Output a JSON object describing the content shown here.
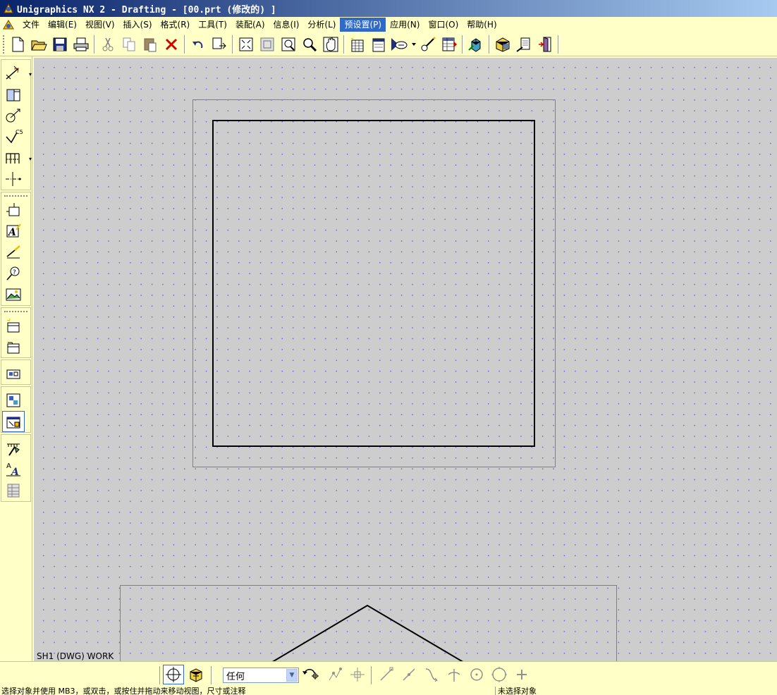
{
  "window": {
    "title": "Unigraphics NX 2 - Drafting - [00.prt  (修改的) ]"
  },
  "menu": [
    {
      "label": "文件"
    },
    {
      "label": "编辑(E)"
    },
    {
      "label": "视图(V)"
    },
    {
      "label": "插入(S)"
    },
    {
      "label": "格式(R)"
    },
    {
      "label": "工具(T)"
    },
    {
      "label": "装配(A)"
    },
    {
      "label": "信息(I)"
    },
    {
      "label": "分析(L)"
    },
    {
      "label": "预设置(P)",
      "active": true
    },
    {
      "label": "应用(N)"
    },
    {
      "label": "窗口(O)"
    },
    {
      "label": "帮助(H)"
    }
  ],
  "canvas": {
    "sheet_label": "SH1 (DWG) WORK",
    "background": "#cdcdcd",
    "grid_color": "#6a6ad0"
  },
  "selection": {
    "filter_value": "任何"
  },
  "status": {
    "left": "选择对象并使用 MB3，或双击，或按住并拖动来移动视图，尺寸或注释",
    "right": "未选择对象"
  },
  "colors": {
    "menu_highlight": "#316ac5",
    "toolbar_bg": "#ffffc8",
    "title_start": "#0a246a",
    "title_end": "#a6caf0"
  }
}
